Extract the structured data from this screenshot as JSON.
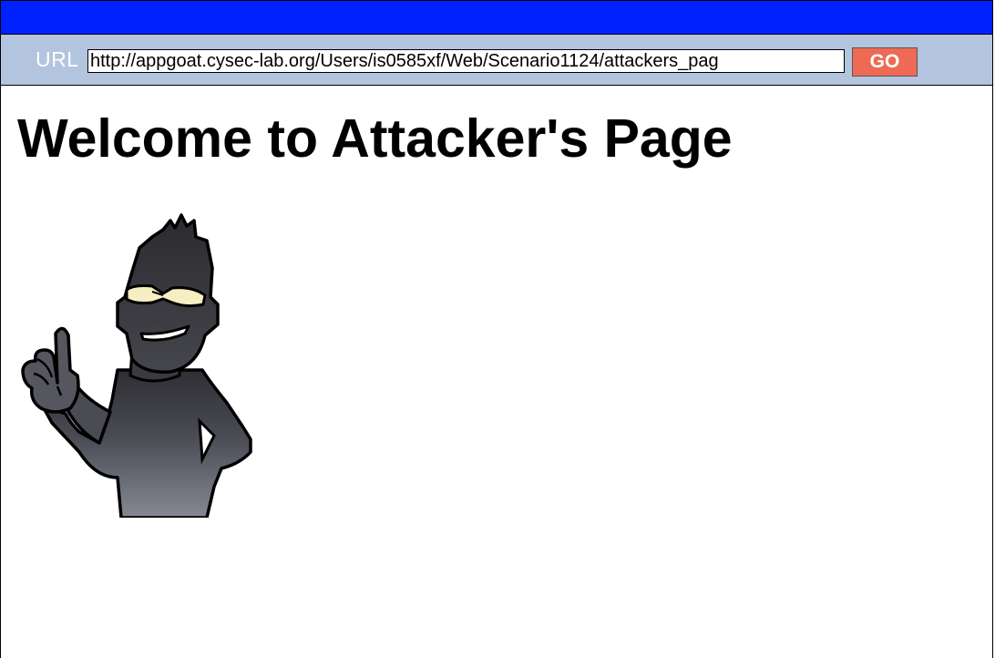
{
  "address_bar": {
    "label": "URL",
    "value": "http://appgoat.cysec-lab.org/Users/is0585xf/Web/Scenario1124/attackers_pag",
    "go_label": "GO"
  },
  "page": {
    "title": "Welcome to Attacker's Page"
  },
  "colors": {
    "title_bar": "#0022ff",
    "address_bar": "#b3c4df",
    "go_button": "#ef6a55"
  },
  "icons": {
    "mascot": "attacker-character-icon"
  }
}
